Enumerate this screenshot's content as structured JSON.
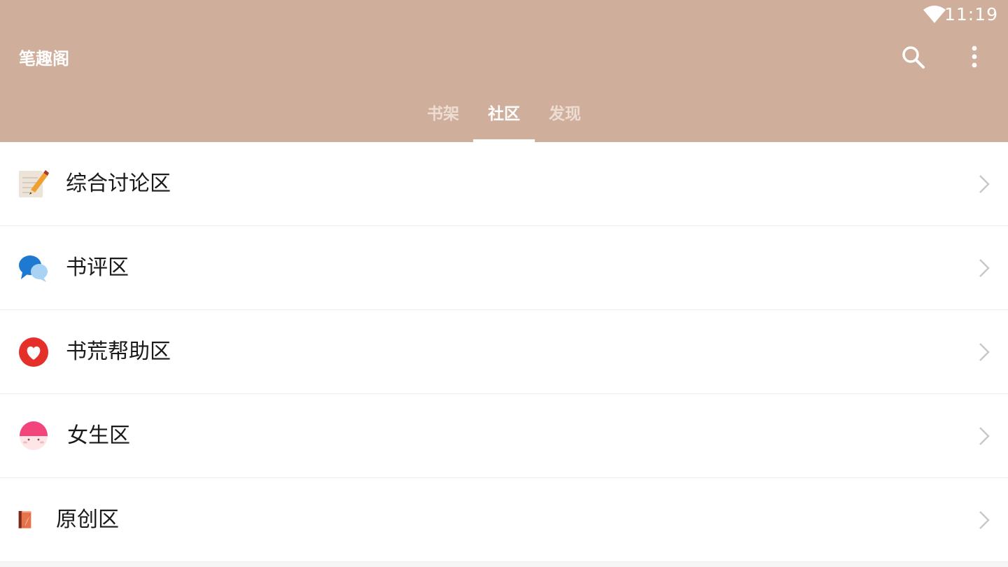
{
  "status_bar": {
    "time": "11:19",
    "wifi_icon": "wifi-icon"
  },
  "toolbar": {
    "title": "笔趣阁",
    "search_icon": "search-icon",
    "more_icon": "more-vertical-icon"
  },
  "tabs": [
    {
      "label": "书架",
      "active": false
    },
    {
      "label": "社区",
      "active": true
    },
    {
      "label": "发现",
      "active": false
    }
  ],
  "community_sections": [
    {
      "label": "综合讨论区",
      "icon": "notepad-pencil-icon"
    },
    {
      "label": "书评区",
      "icon": "chat-bubbles-icon"
    },
    {
      "label": "书荒帮助区",
      "icon": "heart-icon"
    },
    {
      "label": "女生区",
      "icon": "girl-face-icon"
    },
    {
      "label": "原创区",
      "icon": "book-quill-icon"
    }
  ],
  "colors": {
    "header_bg": "#cfae9b",
    "tab_inactive": "#ecdcd2",
    "tab_active": "#ffffff",
    "chevron": "#c8c8c8"
  }
}
